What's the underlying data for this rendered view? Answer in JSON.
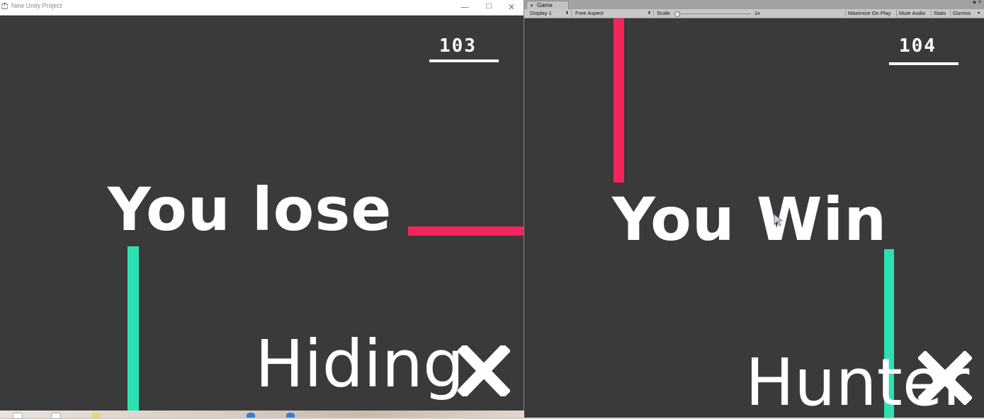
{
  "left_window": {
    "title": "New Unity Project",
    "minimize_glyph": "—",
    "maximize_glyph": "☐",
    "close_glyph": "✕",
    "score": "103",
    "result": "You lose",
    "role": "Hiding",
    "close_icon_glyph": "✖"
  },
  "right_editor": {
    "tab_label": "Game",
    "tab_icon_glyph": "◖",
    "panel_menu_glyph": "▪ ✕",
    "toolbar": {
      "display": "Display 1",
      "aspect": "Free Aspect",
      "scale_label": "Scale",
      "scale_value": "1x",
      "scale_level": 0.0,
      "maximize_on_play": "Maximize On Play",
      "mute_audio": "Mute Audio",
      "stats": "Stats",
      "gizmos": "Gizmos"
    },
    "score": "104",
    "result": "You Win",
    "role": "Hunter",
    "close_icon_glyph": "✖"
  },
  "colors": {
    "background": "#3a3a3a",
    "red_bar": "#f4245c",
    "teal_bar": "#2de0b2",
    "text": "#ffffff"
  }
}
